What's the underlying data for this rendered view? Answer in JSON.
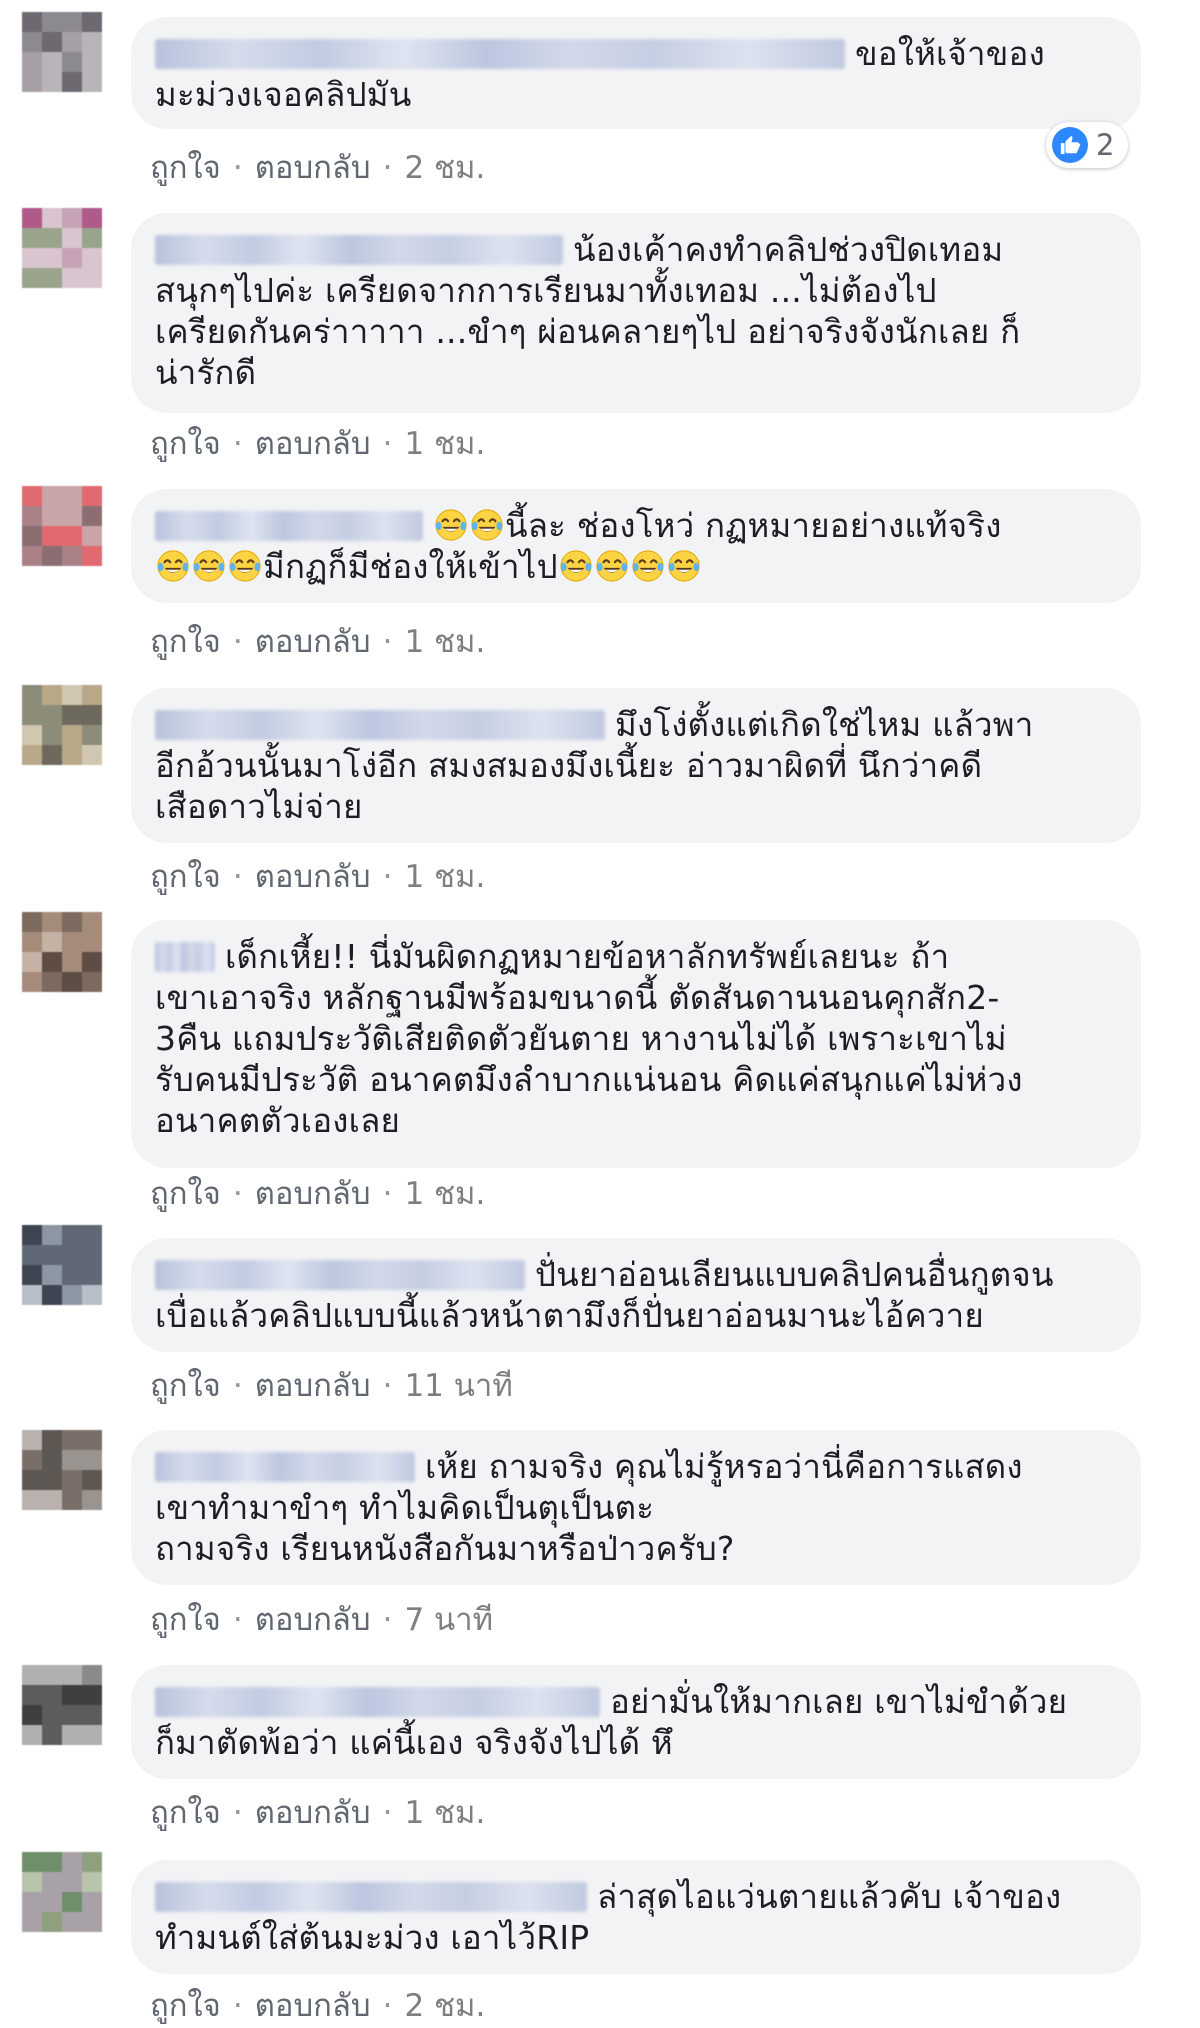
{
  "comments": [
    {
      "lines": [
        "ขอให้เจ้าของ",
        "มะม่วงเจอคลิปมัน"
      ],
      "like": "ถูกใจ",
      "reply": "ตอบกลับ",
      "time": "2 ชม.",
      "reactions": {
        "count": "2",
        "icon": "like-icon"
      }
    },
    {
      "lines": [
        "น้องเค้าคงทำคลิปช่วงปิดเทอม",
        "สนุกๆไปค่ะ เครียดจากการเรียนมาทั้งเทอม ...ไม่ต้องไป",
        "เครียดกันคร่าาาาา ...ขำๆ ผ่อนคลายๆไป อย่าจริงจังนักเลย ก็",
        "น่ารักดี"
      ],
      "like": "ถูกใจ",
      "reply": "ตอบกลับ",
      "time": "1 ชม."
    },
    {
      "lines": [
        "นี้ละ ช่องโหว่ กฏหมายอย่างแท้จริง",
        "มีกฏก็มีช่องให้เข้าไป"
      ],
      "emoji": "tears-of-joy-emoji",
      "like": "ถูกใจ",
      "reply": "ตอบกลับ",
      "time": "1 ชม."
    },
    {
      "lines": [
        "มึงโง่ตั้งแต่เกิดใช่ไหม แล้วพา",
        "อีกอ้วนนั้นมาโง่อีก สมงสมองมึงเนี้ยะ อ่าวมาผิดที่ นึกว่าคดี",
        "เสือดาวไม่จ่าย"
      ],
      "like": "ถูกใจ",
      "reply": "ตอบกลับ",
      "time": "1 ชม."
    },
    {
      "lines": [
        "เด็กเหี้ย!! นี่มันผิดกฏหมายข้อหาลักทรัพย์เลยนะ ถ้า",
        "เขาเอาจริง หลักฐานมีพร้อมขนาดนี้ ตัดสันดานนอนคุกสัก2-",
        "3คืน แถมประวัติเสียติดตัวยันตาย หางานไม่ได้ เพราะเขาไม่",
        "รับคนมีประวัติ อนาคตมึงลำบากแน่นอน คิดแค่สนุกแค่ไม่ห่วง",
        "อนาคตตัวเองเลย"
      ],
      "like": "ถูกใจ",
      "reply": "ตอบกลับ",
      "time": "1 ชม."
    },
    {
      "lines": [
        "ปั่นยาอ่อนเลียนแบบคลิปคนอื่นกูตจน",
        "เบื่อแล้วคลิปแบบนี้แล้วหน้าตามึงก็ปั่นยาอ่อนมานะไอ้ควาย"
      ],
      "like": "ถูกใจ",
      "reply": "ตอบกลับ",
      "time": "11 นาที"
    },
    {
      "lines": [
        "เห้ย ถามจริง คุณไม่รู้หรอว่านี่คือการแสดง",
        "เขาทำมาขำๆ ทำไมคิดเป็นตุเป็นตะ",
        "ถามจริง เรียนหนังสือกันมาหรือป่าวครับ?"
      ],
      "like": "ถูกใจ",
      "reply": "ตอบกลับ",
      "time": "7 นาที"
    },
    {
      "lines": [
        "อย่ามั่นให้มากเลย เขาไม่ขำด้วย",
        "ก็มาตัดพ้อว่า แค่นี้เอง จริงจังไปได้ หึ"
      ],
      "like": "ถูกใจ",
      "reply": "ตอบกลับ",
      "time": "1 ชม."
    },
    {
      "lines": [
        "ล่าสุดไอแว่นตายแล้วคับ เจ้าของ",
        "ทำมนต์ใส่ต้นมะม่วง เอาไว้RIP"
      ],
      "like": "ถูกใจ",
      "reply": "ตอบกลับ",
      "time": "2 ชม."
    }
  ],
  "colors": {
    "bubble": "#f2f3f5",
    "action_link": "#616770",
    "like_blue": "#2d88ff",
    "name_blur": "#c6cee3"
  }
}
